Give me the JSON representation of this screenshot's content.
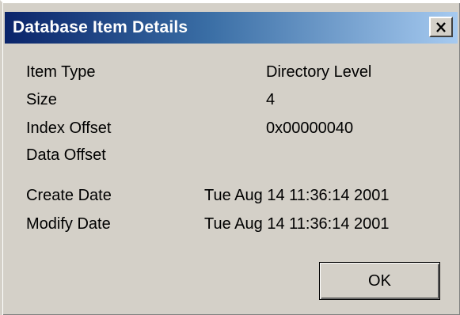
{
  "window": {
    "title": "Database Item Details",
    "close_icon": "close-icon"
  },
  "details": {
    "item_type": {
      "label": "Item Type",
      "value": "Directory Level"
    },
    "size": {
      "label": "Size",
      "value": "4"
    },
    "index_offset": {
      "label": "Index Offset",
      "value": "0x00000040"
    },
    "data_offset": {
      "label": "Data Offset",
      "value": ""
    },
    "create_date": {
      "label": "Create Date",
      "value": "Tue Aug 14 11:36:14 2001"
    },
    "modify_date": {
      "label": "Modify Date",
      "value": "Tue Aug 14 11:36:14 2001"
    }
  },
  "buttons": {
    "ok_label": "OK"
  },
  "colors": {
    "titlebar_start": "#0a246a",
    "titlebar_end": "#a6caf0",
    "dialog_face": "#d4d0c8"
  }
}
